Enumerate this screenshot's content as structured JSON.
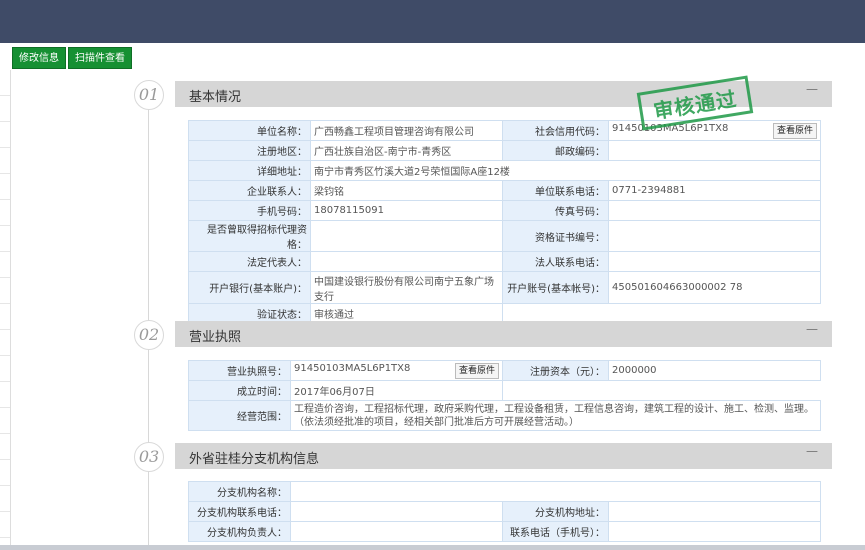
{
  "toolbar": {
    "edit_label": "修改信息",
    "scan_label": "扫描件查看"
  },
  "stamp_text": "审核通过",
  "section1": {
    "num": "01",
    "title": "基本情况",
    "minimize": "—",
    "view_btn": "查看原件",
    "rows": [
      {
        "l1": "单位名称：",
        "v1": "广西畅鑫工程项目管理咨询有限公司",
        "l2": "社会信用代码：",
        "v2": "91450103MA5L6P1TX8"
      },
      {
        "l1": "注册地区：",
        "v1": "广西壮族自治区-南宁市-青秀区",
        "l2": "邮政编码：",
        "v2": ""
      },
      {
        "l1": "详细地址：",
        "v1": "南宁市青秀区竹溪大道2号荣恒国际A座12楼"
      },
      {
        "l1": "企业联系人：",
        "v1": "梁钧铭",
        "l2": "单位联系电话：",
        "v2": "0771-2394881"
      },
      {
        "l1": "手机号码：",
        "v1": "18078115091",
        "l2": "传真号码：",
        "v2": ""
      },
      {
        "l1": "是否曾取得招标代理资格：",
        "v1": "",
        "l2": "资格证书编号：",
        "v2": ""
      },
      {
        "l1": "法定代表人：",
        "v1": "",
        "l2": "法人联系电话：",
        "v2": ""
      },
      {
        "l1": "开户银行(基本账户)：",
        "v1": "中国建设银行股份有限公司南宁五象广场支行",
        "l2": "开户账号(基本帐号)：",
        "v2": "450501604663000002 78"
      },
      {
        "l1": "验证状态：",
        "v1": "审核通过"
      }
    ]
  },
  "section2": {
    "num": "02",
    "title": "营业执照",
    "minimize": "—",
    "view_btn": "查看原件",
    "license_label": "营业执照号：",
    "license_value": "91450103MA5L6P1TX8",
    "capital_label": "注册资本（元）：",
    "capital_value": "2000000",
    "founded_label": "成立时间：",
    "founded_value": "2017年06月07日",
    "scope_label": "经营范围：",
    "scope_value": "工程造价咨询，工程招标代理，政府采购代理，工程设备租赁，工程信息咨询，建筑工程的设计、施工、检测、监理。（依法须经批准的项目，经相关部门批准后方可开展经营活动。）"
  },
  "section3": {
    "num": "03",
    "title": "外省驻桂分支机构信息",
    "minimize": "—",
    "name_label": "分支机构名称：",
    "name_value": "",
    "phone_label": "分支机构联系电话：",
    "phone_value": "",
    "addr_label": "分支机构地址：",
    "addr_value": "",
    "head_label": "分支机构负责人：",
    "head_value": "",
    "mobile_label": "联系电话（手机号）：",
    "mobile_value": ""
  }
}
